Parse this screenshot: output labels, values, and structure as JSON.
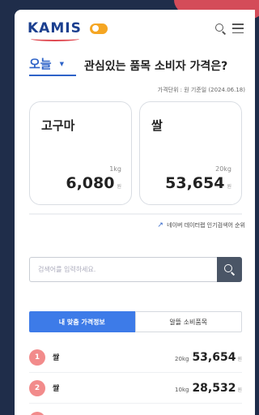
{
  "header": {
    "logo_text": "KAMIS",
    "icons": [
      "search-icon",
      "menu-icon"
    ]
  },
  "title": {
    "period_selected": "오늘",
    "period_caret": "▼",
    "heading": "관심있는 품목 소비자 가격은?"
  },
  "unit_info": "가격단위 : 원   기준일 (2024.06.18)",
  "cards": [
    {
      "name": "고구마",
      "qty": "1kg",
      "price": "6,080",
      "currency": "원"
    },
    {
      "name": "쌀",
      "qty": "20kg",
      "price": "53,654",
      "currency": "원"
    }
  ],
  "naver_trend": "네이버 데이터랩 인기검색어 순위",
  "search": {
    "placeholder": "검색어를 입력하세요."
  },
  "tabs": [
    {
      "label": "내 맞춤 가격정보",
      "active": true
    },
    {
      "label": "알뜰 소비품목",
      "active": false
    }
  ],
  "ranking": [
    {
      "rank": "1",
      "name": "쌀",
      "qty": "20kg",
      "price": "53,654",
      "currency": "원"
    },
    {
      "rank": "2",
      "name": "쌀",
      "qty": "10kg",
      "price": "28,532",
      "currency": "원"
    }
  ],
  "colors": {
    "brand_blue": "#1b3f8f",
    "accent_blue": "#3d7be8",
    "rank_badge": "#f28b8b",
    "toggle_orange": "#f5a623",
    "background": "#1f2d4a"
  }
}
